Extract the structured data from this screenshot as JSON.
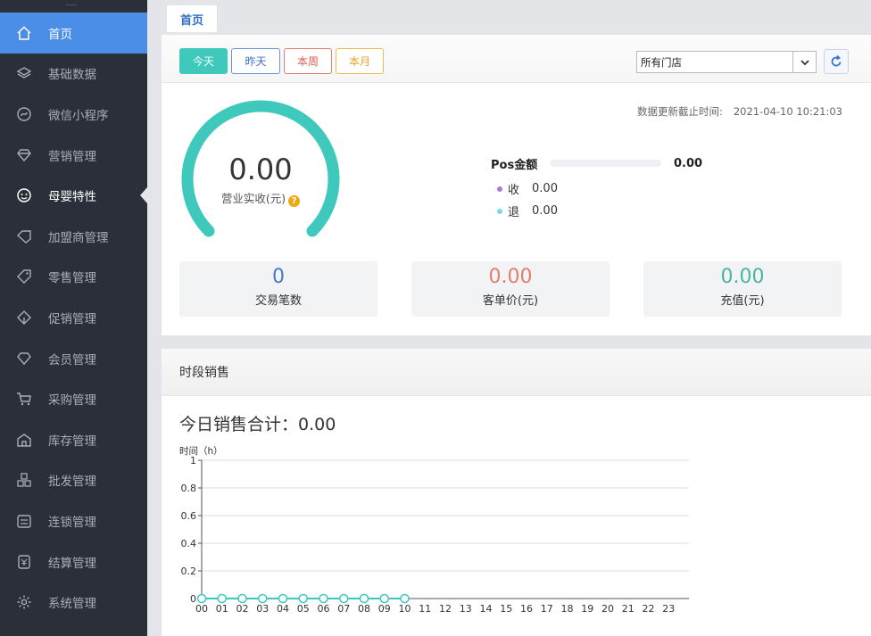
{
  "sidebar": {
    "items": [
      {
        "label": "首页",
        "icon": "home-icon"
      },
      {
        "label": "基础数据",
        "icon": "layers-icon"
      },
      {
        "label": "微信小程序",
        "icon": "miniprogram-icon"
      },
      {
        "label": "营销管理",
        "icon": "diamond-icon"
      },
      {
        "label": "母婴特性",
        "icon": "baby-icon"
      },
      {
        "label": "加盟商管理",
        "icon": "franchise-icon"
      },
      {
        "label": "零售管理",
        "icon": "tag-icon"
      },
      {
        "label": "促销管理",
        "icon": "promo-icon"
      },
      {
        "label": "会员管理",
        "icon": "member-icon"
      },
      {
        "label": "采购管理",
        "icon": "cart-icon"
      },
      {
        "label": "库存管理",
        "icon": "warehouse-icon"
      },
      {
        "label": "批发管理",
        "icon": "boxes-icon"
      },
      {
        "label": "连锁管理",
        "icon": "store-icon"
      },
      {
        "label": "结算管理",
        "icon": "settlement-icon"
      },
      {
        "label": "系统管理",
        "icon": "gear-icon"
      }
    ],
    "active_index": 0,
    "open_index": 4
  },
  "tabs": [
    {
      "label": "首页"
    }
  ],
  "toolbar": {
    "periods": [
      {
        "label": "今天",
        "color": "#3fc9bd"
      },
      {
        "label": "昨天",
        "color": "#3b6fcf"
      },
      {
        "label": "本周",
        "color": "#e05b50"
      },
      {
        "label": "本月",
        "color": "#e8a62c"
      }
    ],
    "store_select": {
      "value": "所有门店"
    }
  },
  "update": {
    "label": "数据更新截止时间:",
    "time": "2021-04-10 10:21:03"
  },
  "gauge": {
    "value": "0.00",
    "label": "营业实收(元)",
    "color": "#3fc9bd"
  },
  "pos": {
    "label": "Pos金额",
    "amount": "0.00",
    "progress": 0,
    "income": {
      "label": "收",
      "value": "0.00",
      "color": "#a87dd0"
    },
    "refund": {
      "label": "退",
      "value": "0.00",
      "color": "#7fd4f0"
    }
  },
  "stats": [
    {
      "value": "0",
      "label": "交易笔数",
      "color": "#4a78c8"
    },
    {
      "value": "0.00",
      "label": "客单价(元)",
      "color": "#e07f6e"
    },
    {
      "value": "0.00",
      "label": "充值(元)",
      "color": "#4ab5a2"
    }
  ],
  "hourly": {
    "title": "时段销售",
    "total_label": "今日销售合计：0.00",
    "y_axis_label": "时间（h）"
  },
  "chart_data": {
    "type": "line",
    "title": "",
    "xlabel": "",
    "ylabel": "时间（h）",
    "categories": [
      "00",
      "01",
      "02",
      "03",
      "04",
      "05",
      "06",
      "07",
      "08",
      "09",
      "10",
      "11",
      "12",
      "13",
      "14",
      "15",
      "16",
      "17",
      "18",
      "19",
      "20",
      "21",
      "22",
      "23"
    ],
    "y_ticks": [
      "0",
      "0.2",
      "0.4",
      "0.6",
      "0.8",
      "1"
    ],
    "ylim": [
      0,
      1
    ],
    "grid": true,
    "series": [
      {
        "values": [
          0,
          0,
          0,
          0,
          0,
          0,
          0,
          0,
          0,
          0,
          0
        ],
        "color": "#3fc9bd"
      }
    ]
  }
}
